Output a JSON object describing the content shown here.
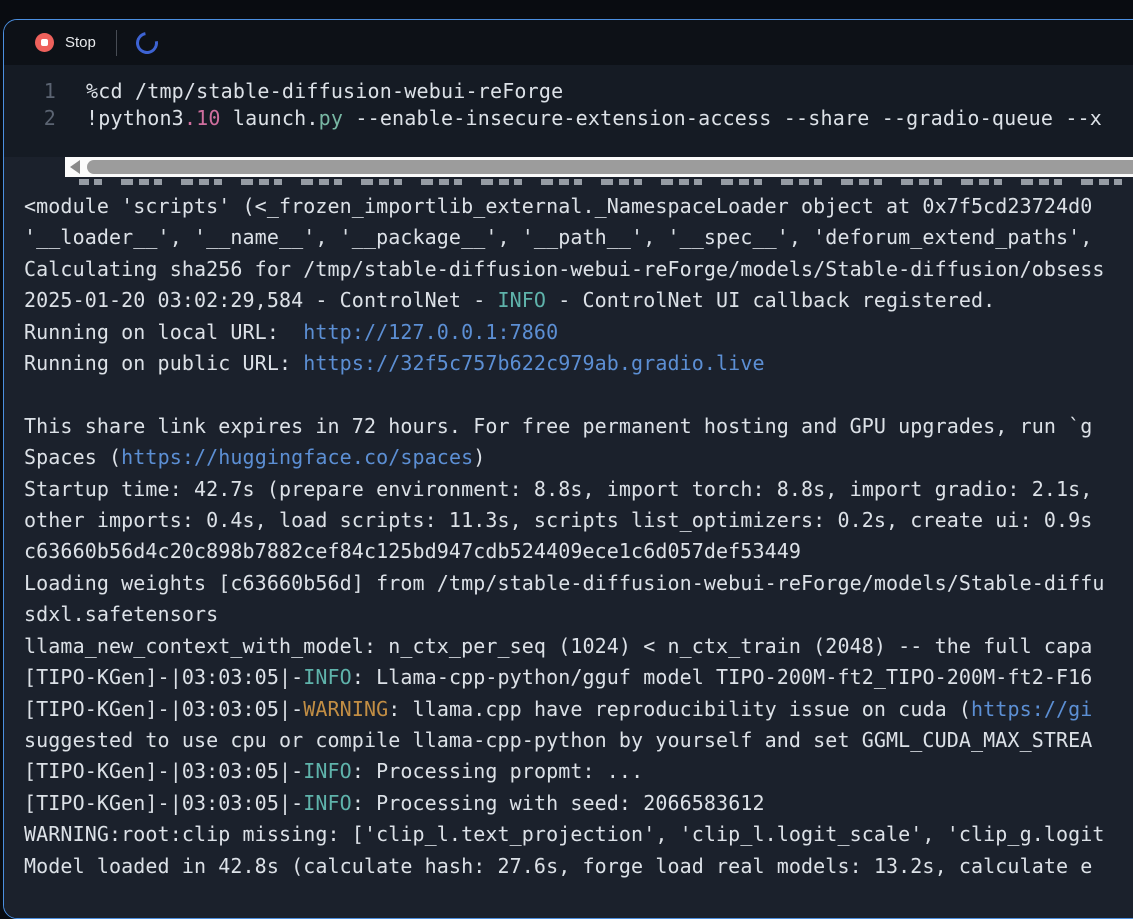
{
  "toolbar": {
    "stop_label": "Stop"
  },
  "colors": {
    "plain": "#dce1e7",
    "pink": "#cf6e9e",
    "green": "#78b8a4",
    "info": "#5fb3ab",
    "warn": "#c28e44",
    "link": "#5c8fd4"
  },
  "code": {
    "lines": [
      {
        "number": "1",
        "segments": [
          {
            "t": "%cd /tmp/stable-diffusion-webui-reForge",
            "c": "plain"
          }
        ]
      },
      {
        "number": "2",
        "segments": [
          {
            "t": "!python3",
            "c": "plain"
          },
          {
            "t": ".10",
            "c": "pink"
          },
          {
            "t": " launch.",
            "c": "plain"
          },
          {
            "t": "py",
            "c": "green"
          },
          {
            "t": " --enable-insecure-extension-access --share --gradio-queue --x",
            "c": "plain"
          }
        ]
      }
    ]
  },
  "output": {
    "lines": [
      {
        "segments": [
          {
            "t": "<module 'scripts' (<_frozen_importlib_external._NamespaceLoader object at 0x7f5cd23724d0",
            "c": "plain"
          }
        ]
      },
      {
        "segments": [
          {
            "t": "'__loader__', '__name__', '__package__', '__path__', '__spec__', 'deforum_extend_paths',",
            "c": "plain"
          }
        ]
      },
      {
        "segments": [
          {
            "t": "Calculating sha256 for /tmp/stable-diffusion-webui-reForge/models/Stable-diffusion/obsess",
            "c": "plain"
          }
        ]
      },
      {
        "segments": [
          {
            "t": "2025-01-20 03:02:29,584 - ControlNet - ",
            "c": "plain"
          },
          {
            "t": "INFO",
            "c": "info"
          },
          {
            "t": " - ControlNet UI callback registered.",
            "c": "plain"
          }
        ]
      },
      {
        "segments": [
          {
            "t": "Running on local URL:  ",
            "c": "plain"
          },
          {
            "t": "http://127.0.0.1:7860",
            "c": "link"
          }
        ]
      },
      {
        "segments": [
          {
            "t": "Running on public URL: ",
            "c": "plain"
          },
          {
            "t": "https://32f5c757b622c979ab.gradio.live",
            "c": "link"
          }
        ]
      },
      {
        "segments": []
      },
      {
        "segments": [
          {
            "t": "This share link expires in 72 hours. For free permanent hosting and GPU upgrades, run `g",
            "c": "plain"
          }
        ]
      },
      {
        "segments": [
          {
            "t": "Spaces (",
            "c": "plain"
          },
          {
            "t": "https://huggingface.co/spaces",
            "c": "link"
          },
          {
            "t": ")",
            "c": "plain"
          }
        ]
      },
      {
        "segments": [
          {
            "t": "Startup time: 42.7s (prepare environment: 8.8s, import torch: 8.8s, import gradio: 2.1s,",
            "c": "plain"
          }
        ]
      },
      {
        "segments": [
          {
            "t": "other imports: 0.4s, load scripts: 11.3s, scripts list_optimizers: 0.2s, create ui: 0.9s",
            "c": "plain"
          }
        ]
      },
      {
        "segments": [
          {
            "t": "c63660b56d4c20c898b7882cef84c125bd947cdb524409ece1c6d057def53449",
            "c": "plain"
          }
        ]
      },
      {
        "segments": [
          {
            "t": "Loading weights [c63660b56d] from /tmp/stable-diffusion-webui-reForge/models/Stable-diffu",
            "c": "plain"
          }
        ]
      },
      {
        "segments": [
          {
            "t": "sdxl.safetensors",
            "c": "plain"
          }
        ]
      },
      {
        "segments": [
          {
            "t": "llama_new_context_with_model: n_ctx_per_seq (1024) < n_ctx_train (2048) -- the full capa",
            "c": "plain"
          }
        ]
      },
      {
        "segments": [
          {
            "t": "[TIPO-KGen]-|03:03:05|-",
            "c": "plain"
          },
          {
            "t": "INFO",
            "c": "info"
          },
          {
            "t": ": Llama-cpp-python/gguf model TIPO-200M-ft2_TIPO-200M-ft2-F16",
            "c": "plain"
          }
        ]
      },
      {
        "segments": [
          {
            "t": "[TIPO-KGen]-|03:03:05|-",
            "c": "plain"
          },
          {
            "t": "WARNING",
            "c": "warn"
          },
          {
            "t": ": llama.cpp have reproducibility issue on cuda (",
            "c": "plain"
          },
          {
            "t": "https://gi",
            "c": "link"
          }
        ]
      },
      {
        "segments": [
          {
            "t": "suggested to use cpu or compile llama-cpp-python by yourself and set GGML_CUDA_MAX_STREA",
            "c": "plain"
          }
        ]
      },
      {
        "segments": [
          {
            "t": "[TIPO-KGen]-|03:03:05|-",
            "c": "plain"
          },
          {
            "t": "INFO",
            "c": "info"
          },
          {
            "t": ": Processing propmt: ...",
            "c": "plain"
          }
        ]
      },
      {
        "segments": [
          {
            "t": "[TIPO-KGen]-|03:03:05|-",
            "c": "plain"
          },
          {
            "t": "INFO",
            "c": "info"
          },
          {
            "t": ": Processing with seed: 2066583612",
            "c": "plain"
          }
        ]
      },
      {
        "segments": [
          {
            "t": "WARNING:root:clip missing: ['clip_l.text_projection', 'clip_l.logit_scale', 'clip_g.logit",
            "c": "plain"
          }
        ]
      },
      {
        "segments": [
          {
            "t": "Model loaded in 42.8s (calculate hash: 27.6s, forge load real models: 13.2s, calculate e",
            "c": "plain"
          }
        ]
      }
    ]
  }
}
